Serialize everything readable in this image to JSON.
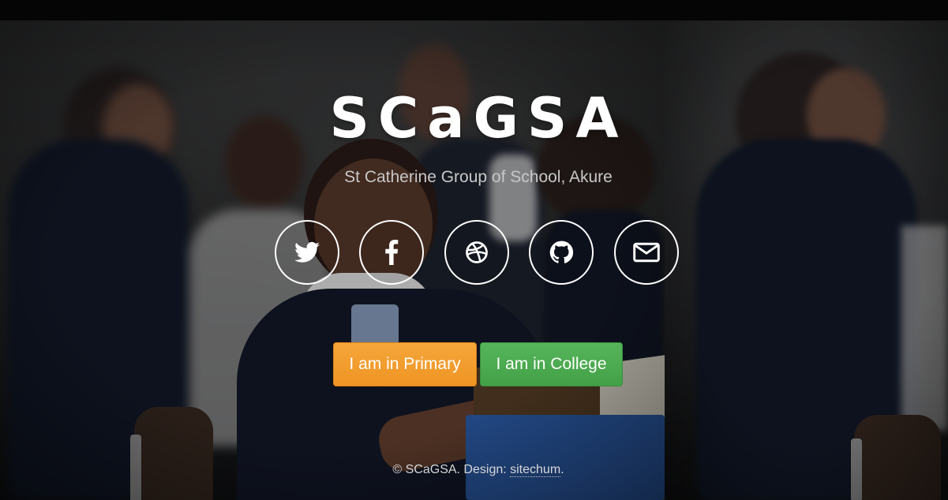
{
  "site": {
    "title": "SCaGSA",
    "subtitle": "St Catherine Group of School, Akure"
  },
  "social": [
    {
      "icon": "twitter-icon"
    },
    {
      "icon": "facebook-icon"
    },
    {
      "icon": "dribbble-icon"
    },
    {
      "icon": "github-icon"
    },
    {
      "icon": "envelope-icon"
    }
  ],
  "actions": {
    "primary_label": "I am in Primary",
    "college_label": "I am in College"
  },
  "footer": {
    "copyright": "© SCaGSA. Design: ",
    "design_link": "sitechum",
    "end": "."
  },
  "colors": {
    "primary_button": "#f0962a",
    "college_button": "#4caf50",
    "text": "#ffffff"
  }
}
